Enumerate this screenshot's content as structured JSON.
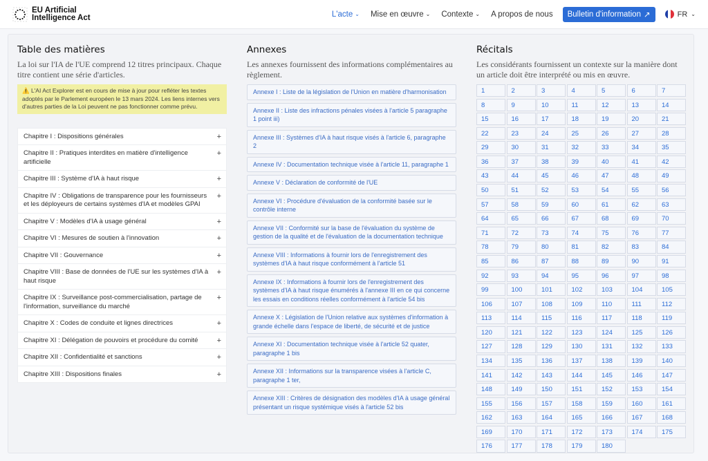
{
  "brand": {
    "name_line1": "EU Artificial",
    "name_line2": "Intelligence Act"
  },
  "nav": {
    "items": [
      {
        "label": "L'acte",
        "caret": true,
        "active": true
      },
      {
        "label": "Mise en œuvre",
        "caret": true,
        "active": false
      },
      {
        "label": "Contexte",
        "caret": true,
        "active": false
      },
      {
        "label": "A propos de nous",
        "caret": false,
        "active": false
      }
    ],
    "bulletin": "Bulletin d'information",
    "lang": "FR"
  },
  "toc": {
    "title": "Table des matières",
    "lead": "La loi sur l'IA de l'UE comprend 12 titres principaux. Chaque titre contient une série d'articles.",
    "notice": "⚠️ L'AI Act Explorer est en cours de mise à jour pour refléter les textes adoptés par le Parlement européen le 13 mars 2024. Les liens internes vers d'autres parties de la Loi peuvent ne pas fonctionner comme prévu.",
    "chapters": [
      "Chapitre I : Dispositions générales",
      "Chapitre II : Pratiques interdites en matière d'intelligence artificielle",
      "Chapitre III : Système d'IA à haut risque",
      "Chapitre IV : Obligations de transparence pour les fournisseurs et les déployeurs de certains systèmes d'IA et modèles GPAI",
      "Chapitre V : Modèles d'IA à usage général",
      "Chapitre VI : Mesures de soutien à l'innovation",
      "Chapitre VII : Gouvernance",
      "Chapitre VIII : Base de données de l'UE sur les systèmes d'IA à haut risque",
      "Chapitre IX : Surveillance post-commercialisation, partage de l'information, surveillance du marché",
      "Chapitre X : Codes de conduite et lignes directrices",
      "Chapitre XI : Délégation de pouvoirs et procédure du comité",
      "Chapitre XII : Confidentialité et sanctions",
      "Chapitre XIII : Dispositions finales"
    ]
  },
  "annexes": {
    "title": "Annexes",
    "lead": "Les annexes fournissent des informations complémentaires au règlement.",
    "items": [
      "Annexe I : Liste de la législation de l'Union en matière d'harmonisation",
      "Annexe II : Liste des infractions pénales visées à l'article 5 paragraphe 1 point iii)",
      "Annexe III : Systèmes d'IA à haut risque visés à l'article 6, paragraphe 2",
      "Annexe IV : Documentation technique visée à l'article 11, paragraphe 1",
      "Annexe V : Déclaration de conformité de l'UE",
      "Annexe VI : Procédure d'évaluation de la conformité basée sur le contrôle interne",
      "Annexe VII : Conformité sur la base de l'évaluation du système de gestion de la qualité et de l'évaluation de la documentation technique",
      "Annexe VIII : Informations à fournir lors de l'enregistrement des systèmes d'IA à haut risque conformément à l'article 51",
      "Annexe IX : Informations à fournir lors de l'enregistrement des systèmes d'IA à haut risque énumérés à l'annexe III en ce qui concerne les essais en conditions réelles conformément à l'article 54 bis",
      "Annexe X : Législation de l'Union relative aux systèmes d'information à grande échelle dans l'espace de liberté, de sécurité et de justice",
      "Annexe XI : Documentation technique visée à l'article 52 quater, paragraphe 1 bis",
      "Annexe XII : Informations sur la transparence visées à l'article C, paragraphe 1 ter,",
      "Annexe XIII : Critères de désignation des modèles d'IA à usage général présentant un risque systémique visés à l'article 52 bis"
    ]
  },
  "recitals": {
    "title": "Récitals",
    "lead": "Les considérants fournissent un contexte sur la manière dont un article doit être interprété ou mis en œuvre.",
    "count": 180
  },
  "colors": {
    "accent": "#2b6cd6",
    "notice": "#f1f0a3"
  }
}
